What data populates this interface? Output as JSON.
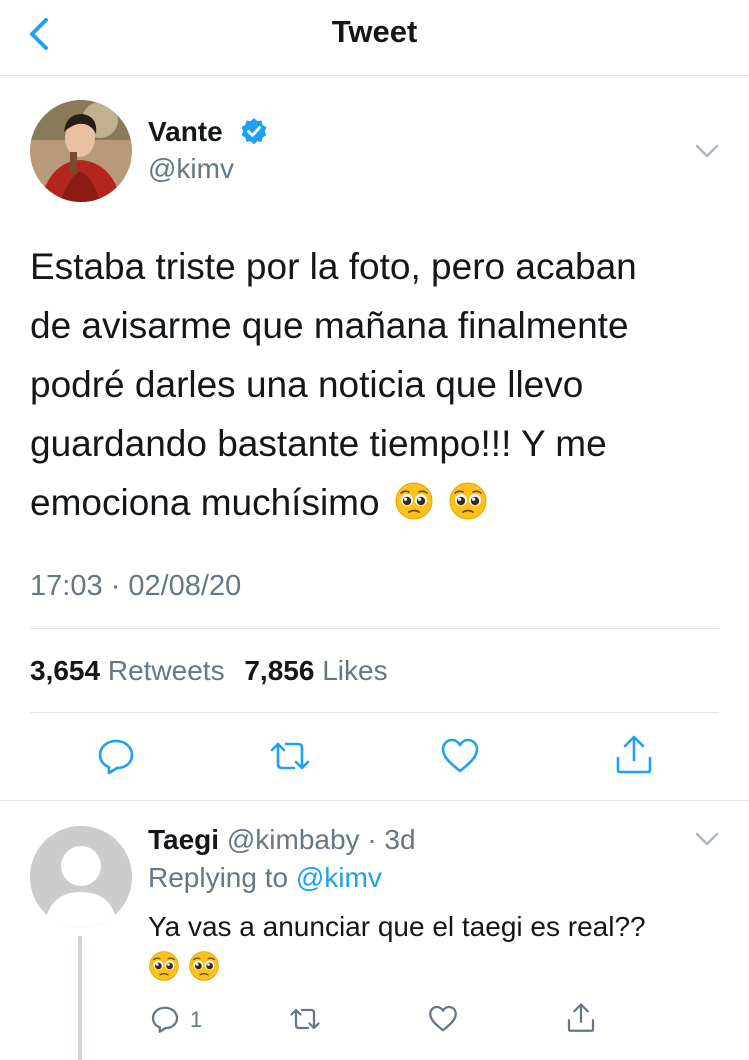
{
  "header": {
    "title": "Tweet"
  },
  "tweet": {
    "author_name": "Vante",
    "author_handle": "@kimv",
    "text": "Estaba triste por la foto, pero acaban\nde avisarme que mañana finalmente\npodré darles una noticia que llevo\nguardando bastante tiempo!!! Y me\nemociona muchísimo",
    "emojis": [
      "pleading-face-emoji",
      "pleading-face-emoji"
    ],
    "timestamp": "17:03 · 02/08/20",
    "retweets_count": "3,654",
    "retweets_label": "Retweets",
    "likes_count": "7,856",
    "likes_label": "Likes"
  },
  "reply": {
    "author_name": "Taegi",
    "author_handle": "@kimbaby",
    "time": "· 3d",
    "replying_prefix": "Replying to",
    "replying_to": "@kimv",
    "text": "Ya vas a anunciar que el taegi es real??",
    "emojis": [
      "pleading-face-emoji",
      "pleading-face-emoji"
    ],
    "reply_count": "1"
  },
  "colors": {
    "accent": "#1da1f2",
    "text_primary": "#14171a",
    "text_secondary": "#657786",
    "divider": "#dfe3e6",
    "verified": "#1da1f2",
    "icon": "#1da1f2"
  }
}
